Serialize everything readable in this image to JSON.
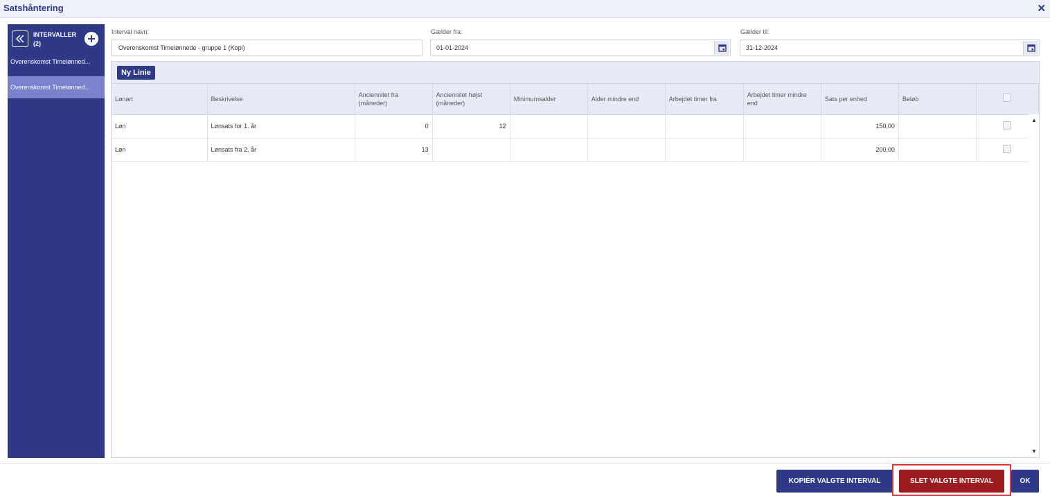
{
  "window": {
    "title": "Satshåntering",
    "close_glyph": "✕"
  },
  "sidebar": {
    "heading_line1": "INTERVALLER",
    "heading_line2": "(2)",
    "items": [
      {
        "label": "Overenskomst Timelønned..."
      },
      {
        "label": "Overenskomst Timelønned..."
      }
    ]
  },
  "form": {
    "interval_name_label": "Interval navn:",
    "interval_name_value": "Overenskomst Timelønnede - gruppe 1  (Kopi)",
    "from_label": "Gælder fra:",
    "from_value": "01-01-2024",
    "to_label": "Gælder til:",
    "to_value": "31-12-2024"
  },
  "toolbar": {
    "new_line_label": "Ny Linie"
  },
  "table": {
    "headers": [
      "Lønart",
      "Beskrivelse",
      "Anciennitet fra (måneder)",
      "Anciennitet højst (måneder)",
      "Minimumsalder",
      "Alder mindre end",
      "Arbejdet timer fra",
      "Arbejdet timer mindre end",
      "Sats per enhed",
      "Beløb"
    ],
    "rows": [
      [
        "Løn",
        "Lønsats for 1. år",
        "0",
        "12",
        "",
        "",
        "",
        "",
        "150,00",
        ""
      ],
      [
        "Løn",
        "Lønsats fra 2. år",
        "13",
        "",
        "",
        "",
        "",
        "",
        "200,00",
        ""
      ]
    ]
  },
  "buttons": {
    "copy": "KOPIÉR VALGTE INTERVAL",
    "delete": "SLET VALGTE INTERVAL",
    "ok": "OK"
  },
  "colors": {
    "brand": "#2e3a87",
    "danger": "#9b1c1f",
    "selected_item": "#7a82cc",
    "highlight": "#e0393c"
  }
}
